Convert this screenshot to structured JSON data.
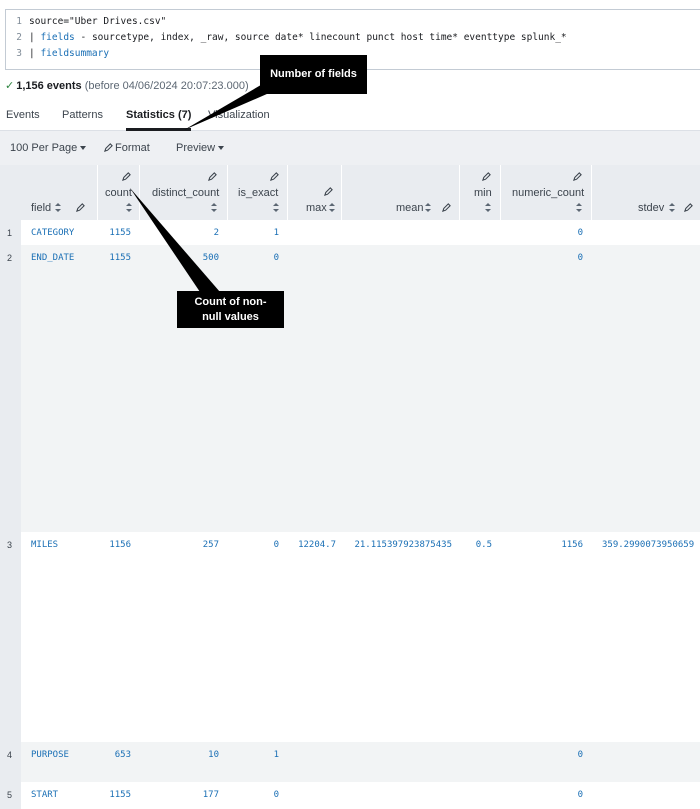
{
  "search": {
    "line_numbers": [
      "1",
      "2",
      "3"
    ],
    "line1": "source=\"Uber Drives.csv\"",
    "line2_pipe": "| ",
    "line2_cmd": "fields",
    "line2_rest": " - sourcetype, index, _raw, source date* linecount punct host time* eventtype splunk_*",
    "line3_pipe": "| ",
    "line3_cmd": "fieldsummary"
  },
  "status": {
    "check": "✓",
    "events": "1,156 events",
    "before": " (before 04/06/2024 20:07:23.000)"
  },
  "tabs": [
    "Events",
    "Patterns",
    "Statistics (7)",
    "Visualization"
  ],
  "active_tab": "Statistics (7)",
  "toolbar": {
    "per_page": "100 Per Page",
    "format": "Format",
    "preview": "Preview"
  },
  "columns": [
    "field",
    "count",
    "distinct_count",
    "is_exact",
    "max",
    "mean",
    "min",
    "numeric_count",
    "stdev"
  ],
  "rows": [
    {
      "num": "1",
      "field": "CATEGORY",
      "count": "1155",
      "distinct_count": "2",
      "is_exact": "1",
      "max": "",
      "mean": "",
      "min": "",
      "numeric_count": "0",
      "stdev": ""
    },
    {
      "num": "2",
      "field": "END_DATE",
      "count": "1155",
      "distinct_count": "500",
      "is_exact": "0",
      "max": "",
      "mean": "",
      "min": "",
      "numeric_count": "0",
      "stdev": ""
    },
    {
      "num": "3",
      "field": "MILES",
      "count": "1156",
      "distinct_count": "257",
      "is_exact": "0",
      "max": "12204.7",
      "mean": "21.115397923875435",
      "min": "0.5",
      "numeric_count": "1156",
      "stdev": "359.2990073950659"
    },
    {
      "num": "4",
      "field": "PURPOSE",
      "count": "653",
      "distinct_count": "10",
      "is_exact": "1",
      "max": "",
      "mean": "",
      "min": "",
      "numeric_count": "0",
      "stdev": ""
    },
    {
      "num": "5",
      "field": "START",
      "count": "1155",
      "distinct_count": "177",
      "is_exact": "0",
      "max": "",
      "mean": "",
      "min": "",
      "numeric_count": "0",
      "stdev": ""
    }
  ],
  "annotations": {
    "fields_callout": "Number of fields",
    "count_callout": "Count of non-null values"
  },
  "colors": {
    "link_blue": "#1a6fb5",
    "header_bg": "#e9ecf0",
    "callout_bg": "#000000",
    "success_green": "#2e8540"
  },
  "icons": [
    "pencil-icon",
    "sort-icon",
    "caret-down-icon",
    "check-icon"
  ]
}
